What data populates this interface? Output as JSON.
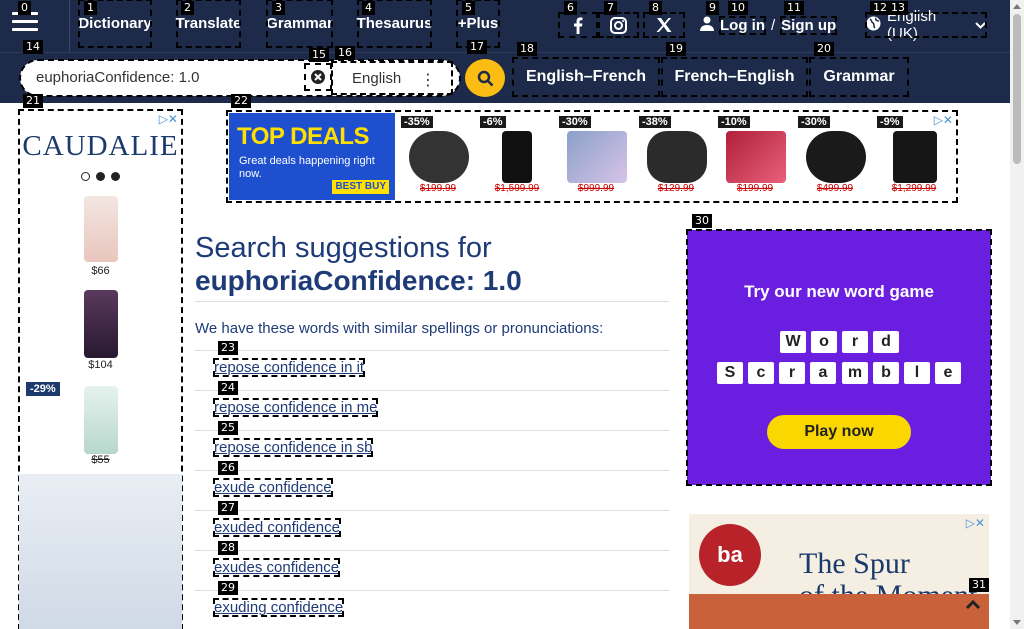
{
  "nav": {
    "items": [
      {
        "tag": "1",
        "label": "Dictionary"
      },
      {
        "tag": "2",
        "label": "Translate"
      },
      {
        "tag": "3",
        "label": "Grammar"
      },
      {
        "tag": "4",
        "label": "Thesaurus"
      },
      {
        "tag": "5",
        "label": "+Plus"
      }
    ],
    "menu_tag": "0",
    "social_tags": [
      "6",
      "7",
      "8"
    ],
    "login_tags": [
      "9",
      "10",
      "11"
    ],
    "login_label": "Log in",
    "login_sep": "/",
    "signup_label": "Sign up",
    "lang_tags": [
      "12",
      "13"
    ],
    "language": "English (UK)"
  },
  "search": {
    "tag": "14",
    "value": "euphoriaConfidence: 1.0",
    "clear_tag": "15",
    "lang_tag": "16",
    "lang_value": "English",
    "go_tag": "17"
  },
  "subnav": [
    {
      "tag": "18",
      "label": "English–French"
    },
    {
      "tag": "19",
      "label": "French–English"
    },
    {
      "tag": "20",
      "label": "Grammar"
    }
  ],
  "left_ad": {
    "tag": "21",
    "brand": "CAUDALIE",
    "prices": [
      "$66",
      "$104",
      "$55"
    ],
    "discount": "-29%",
    "colors": {
      "brand": "#1c3a6b"
    }
  },
  "top_ad": {
    "tag": "22",
    "headline": "TOP DEALS",
    "sub": "Great deals happening right now.",
    "logo": "BEST BUY",
    "deals": [
      {
        "pct": "-35%",
        "price": "$199.99"
      },
      {
        "pct": "-6%",
        "price": "$1,599.99"
      },
      {
        "pct": "-30%",
        "price": "$999.99"
      },
      {
        "pct": "-38%",
        "price": "$129.99"
      },
      {
        "pct": "-10%",
        "price": "$199.99"
      },
      {
        "pct": "-30%",
        "price": "$499.99"
      },
      {
        "pct": "-9%",
        "price": "$1,299.99"
      }
    ]
  },
  "main": {
    "title_prefix": "Search suggestions for",
    "title_query": "euphoriaConfidence: 1.0",
    "intro": "We have these words with similar spellings or pronunciations:",
    "suggestions": [
      {
        "tag": "23",
        "text": "repose confidence in it"
      },
      {
        "tag": "24",
        "text": "repose confidence in me"
      },
      {
        "tag": "25",
        "text": "repose confidence in sb"
      },
      {
        "tag": "26",
        "text": "exude confidence"
      },
      {
        "tag": "27",
        "text": "exuded confidence"
      },
      {
        "tag": "28",
        "text": "exudes confidence"
      },
      {
        "tag": "29",
        "text": "exuding confidence"
      }
    ]
  },
  "game_ad": {
    "tag": "30",
    "title": "Try our new word game",
    "row1": [
      "W",
      "o",
      "r",
      "d"
    ],
    "row2": [
      "S",
      "c",
      "r",
      "a",
      "m",
      "b",
      "l",
      "e"
    ],
    "cta": "Play now",
    "colors": {
      "bg": "#6a1fe0",
      "cta": "#fbd700"
    }
  },
  "spur_ad": {
    "logo": "ba",
    "line1": "The Spur",
    "line2": "of the Moment"
  },
  "scroll_top_tag": "31"
}
